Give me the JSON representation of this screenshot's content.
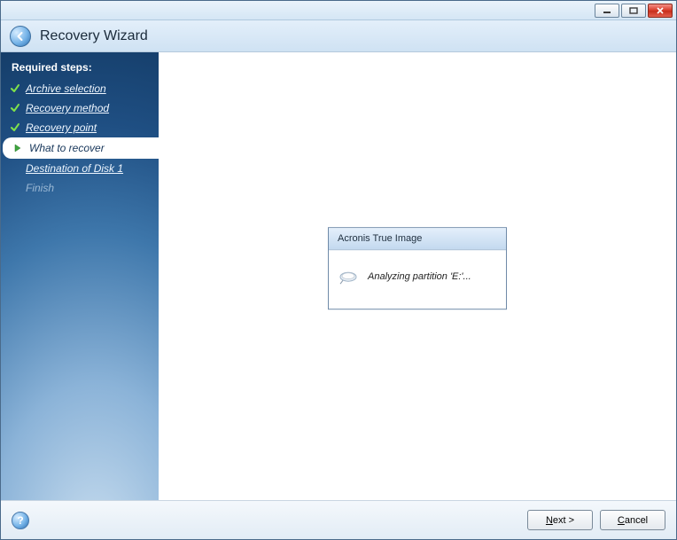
{
  "window": {
    "title": "Recovery Wizard"
  },
  "sidebar": {
    "header": "Required steps:",
    "steps": [
      {
        "label": "Archive selection",
        "state": "done"
      },
      {
        "label": "Recovery method",
        "state": "done"
      },
      {
        "label": "Recovery point",
        "state": "done"
      },
      {
        "label": "What to recover",
        "state": "active"
      },
      {
        "label": "Destination of Disk 1",
        "state": "pending"
      },
      {
        "label": "Finish",
        "state": "dim"
      }
    ]
  },
  "dialog": {
    "title": "Acronis True Image",
    "message": "Analyzing partition 'E:'..."
  },
  "footer": {
    "next": "Next >",
    "next_hotkey": "N",
    "cancel": "Cancel",
    "cancel_hotkey": "C"
  }
}
